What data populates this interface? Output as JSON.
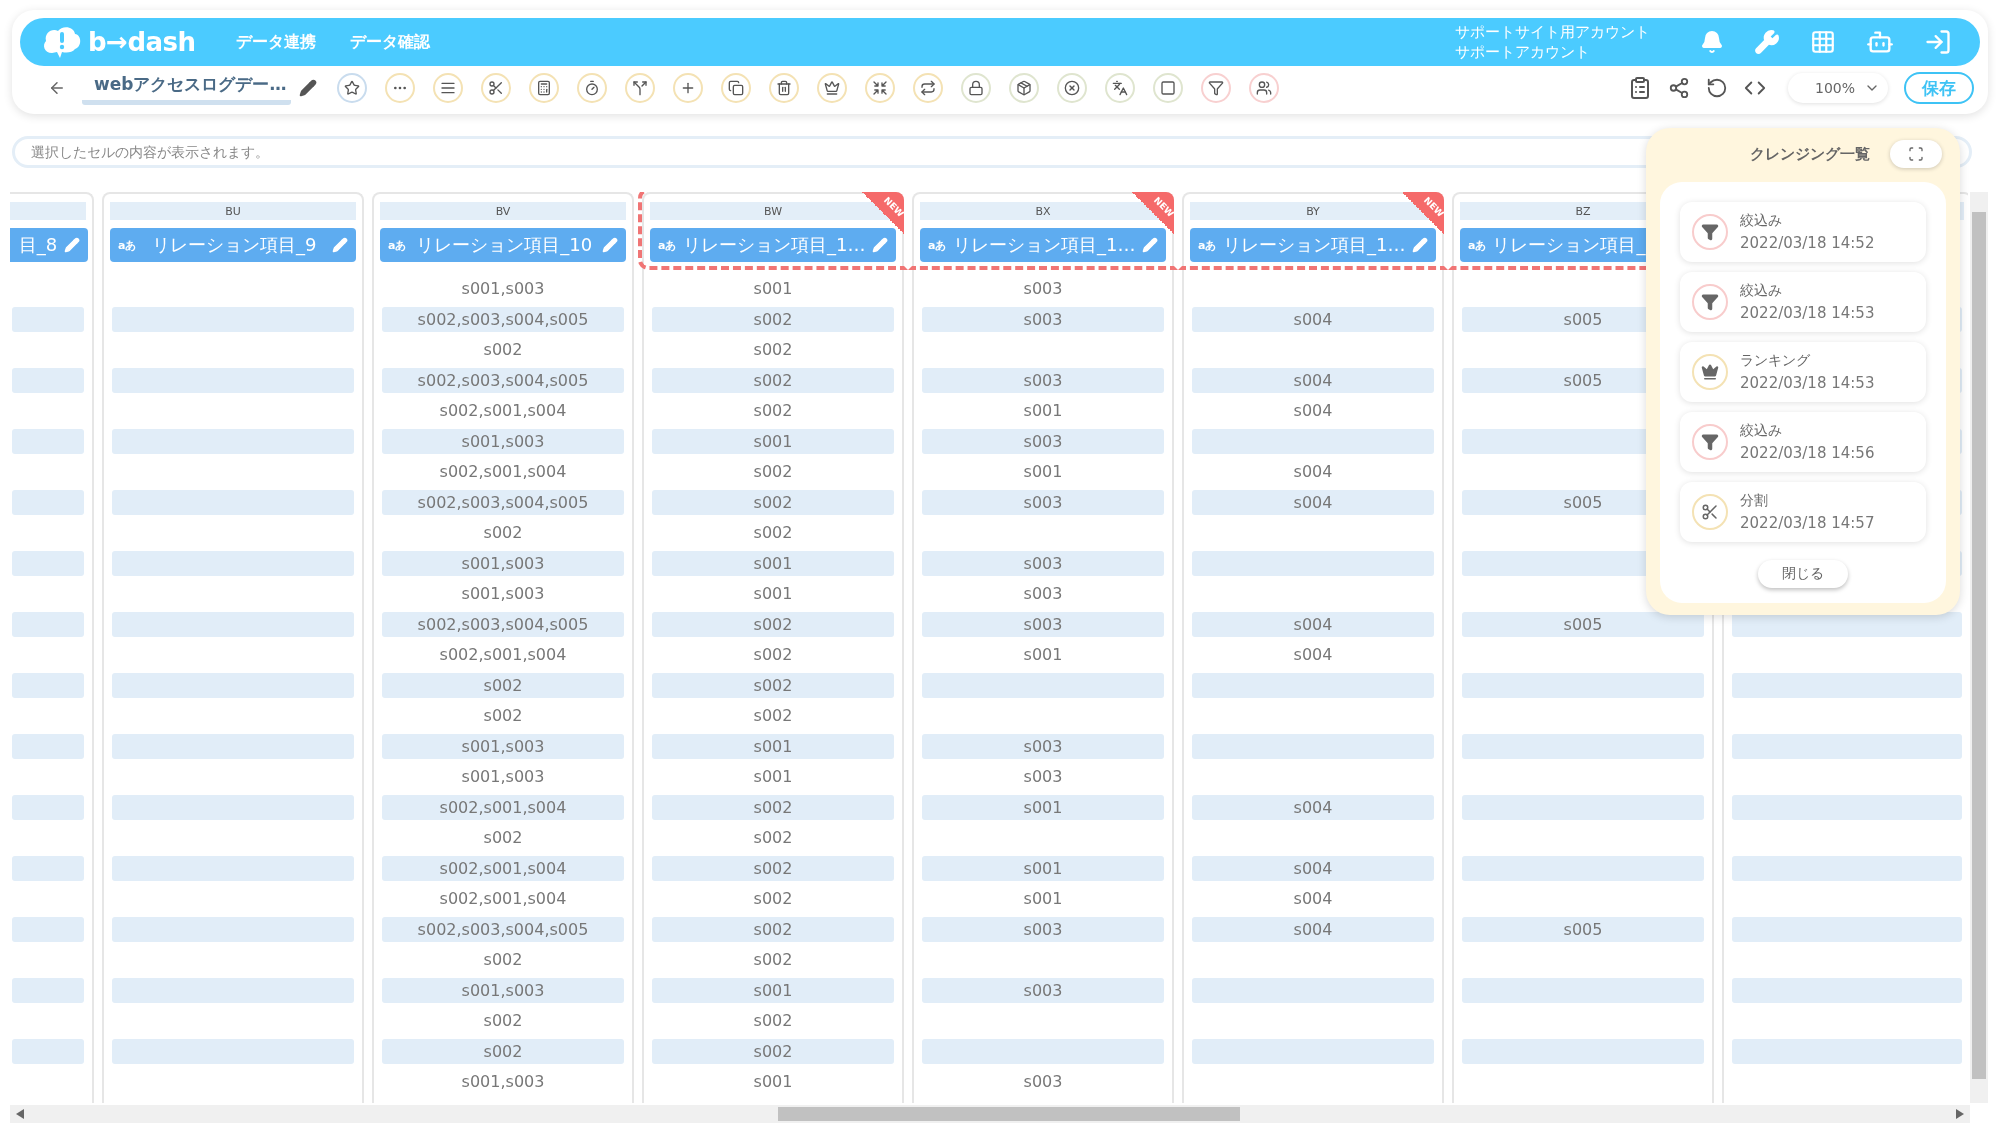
{
  "header": {
    "logo": "b→dash",
    "nav": [
      "データ連携",
      "データ確認"
    ],
    "account": [
      "サポートサイト用アカウント",
      "サポートアカウント"
    ]
  },
  "toolbar": {
    "title": "webアクセスログデー…",
    "zoom": "100%",
    "save": "保存"
  },
  "formula_bar": {
    "placeholder": "選択したセルの内容が表示されます。"
  },
  "columns": [
    {
      "name": "目_8",
      "highlighted": false,
      "cells": [
        null,
        null,
        null,
        null,
        null,
        null,
        null,
        null,
        null,
        null,
        null,
        null,
        null,
        null,
        null,
        null,
        null,
        null,
        null,
        null,
        null,
        null,
        null,
        null,
        null,
        null,
        null
      ]
    },
    {
      "letter": "BU",
      "type_label": "aあ",
      "name": "リレーション項目_9",
      "highlighted": false,
      "cells": [
        null,
        null,
        null,
        null,
        null,
        null,
        null,
        null,
        null,
        null,
        null,
        null,
        null,
        null,
        null,
        null,
        null,
        null,
        null,
        null,
        null,
        null,
        null,
        null,
        null,
        null,
        null
      ]
    },
    {
      "letter": "BV",
      "type_label": "aあ",
      "name": "リレーション項目_10",
      "highlighted": false,
      "cells": [
        "s001,s003",
        "s002,s003,s004,s005",
        "s002",
        "s002,s003,s004,s005",
        "s002,s001,s004",
        "s001,s003",
        "s002,s001,s004",
        "s002,s003,s004,s005",
        "s002",
        "s001,s003",
        "s001,s003",
        "s002,s003,s004,s005",
        "s002,s001,s004",
        "s002",
        "s002",
        "s001,s003",
        "s001,s003",
        "s002,s001,s004",
        "s002",
        "s002,s001,s004",
        "s002,s001,s004",
        "s002,s003,s004,s005",
        "s002",
        "s001,s003",
        "s002",
        "s002",
        "s001,s003"
      ]
    },
    {
      "letter": "BW",
      "type_label": "aあ",
      "name": "リレーション項目_1…",
      "badge": "NEW",
      "highlighted": true,
      "cells": [
        "s001",
        "s002",
        "s002",
        "s002",
        "s002",
        "s001",
        "s002",
        "s002",
        "s002",
        "s001",
        "s001",
        "s002",
        "s002",
        "s002",
        "s002",
        "s001",
        "s001",
        "s002",
        "s002",
        "s002",
        "s002",
        "s002",
        "s002",
        "s001",
        "s002",
        "s002",
        "s001"
      ]
    },
    {
      "letter": "BX",
      "type_label": "aあ",
      "name": "リレーション項目_1…",
      "badge": "NEW",
      "highlighted": true,
      "cells": [
        "s003",
        "s003",
        null,
        "s003",
        "s001",
        "s003",
        "s001",
        "s003",
        null,
        "s003",
        "s003",
        "s003",
        "s001",
        null,
        null,
        "s003",
        "s003",
        "s001",
        null,
        "s001",
        "s001",
        "s003",
        null,
        "s003",
        null,
        null,
        "s003"
      ]
    },
    {
      "letter": "BY",
      "type_label": "aあ",
      "name": "リレーション項目_1…",
      "badge": "NEW",
      "highlighted": true,
      "cells": [
        null,
        "s004",
        null,
        "s004",
        "s004",
        null,
        "s004",
        "s004",
        null,
        null,
        null,
        "s004",
        "s004",
        null,
        null,
        null,
        null,
        "s004",
        null,
        "s004",
        "s004",
        "s004",
        null,
        null,
        null,
        null,
        null
      ]
    },
    {
      "letter": "BZ",
      "type_label": "aあ",
      "name": "リレーション項目_",
      "highlighted": true,
      "cells": [
        null,
        "s005",
        null,
        "s005",
        null,
        null,
        null,
        "s005",
        null,
        null,
        null,
        "s005",
        null,
        null,
        null,
        null,
        null,
        null,
        null,
        null,
        null,
        "s005",
        null,
        null,
        null,
        null,
        null
      ]
    },
    {
      "highlighted": false,
      "cells": [
        null,
        null,
        null,
        null,
        null,
        null,
        null,
        null,
        null,
        null,
        null,
        null,
        null,
        null,
        null,
        null,
        null,
        null,
        null,
        null,
        null,
        null,
        null,
        null,
        null,
        null,
        null
      ]
    }
  ],
  "panel": {
    "title": "クレンジング一覧",
    "items": [
      {
        "kind": "filter",
        "label": "絞込み",
        "time": "2022/03/18 14:52"
      },
      {
        "kind": "filter",
        "label": "絞込み",
        "time": "2022/03/18 14:53"
      },
      {
        "kind": "ranking",
        "label": "ランキング",
        "time": "2022/03/18 14:53"
      },
      {
        "kind": "filter",
        "label": "絞込み",
        "time": "2022/03/18 14:56"
      },
      {
        "kind": "split",
        "label": "分割",
        "time": "2022/03/18 14:57"
      }
    ],
    "close": "閉じる"
  }
}
